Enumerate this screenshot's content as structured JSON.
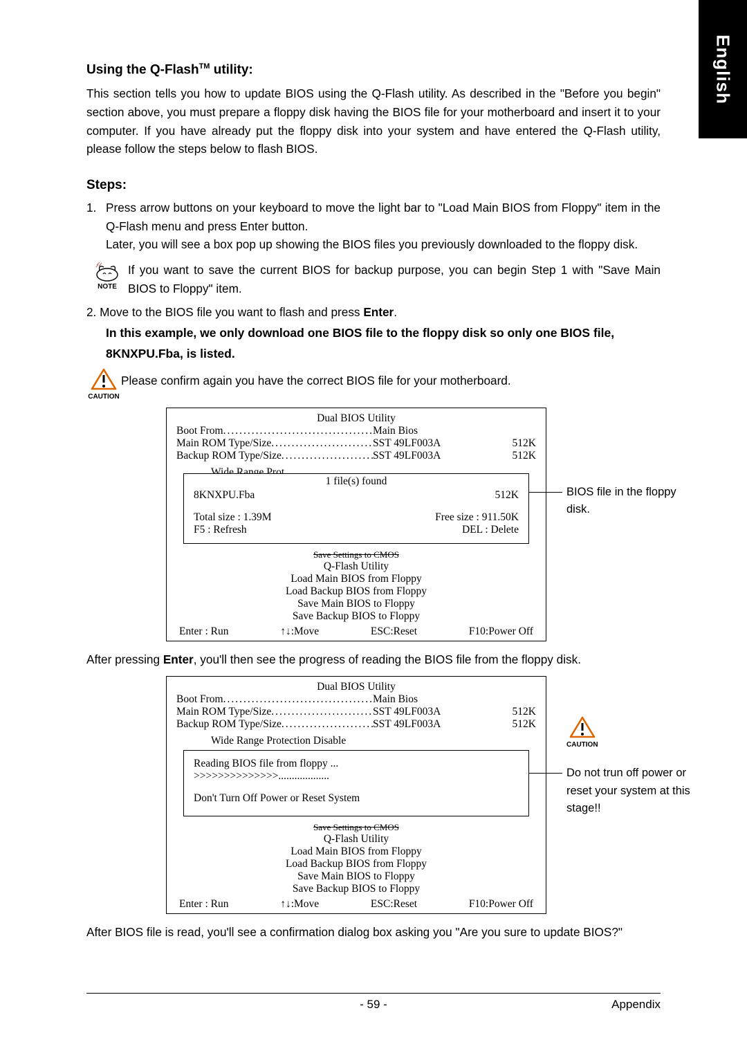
{
  "sideTab": "English",
  "heading1_prefix": "Using the Q-Flash",
  "heading1_tm": "TM",
  "heading1_suffix": " utility:",
  "intro": "This section tells you how to update BIOS using the Q-Flash utility. As described in the \"Before you begin\" section above, you must prepare a floppy disk having the BIOS file for your motherboard and insert it to your computer. If you have already put the floppy disk into your system and have entered the Q-Flash utility, please follow the steps below to flash BIOS.",
  "stepsHeading": "Steps:",
  "step1num": "1.",
  "step1a": "Press arrow buttons on your keyboard to move the light bar to \"Load Main BIOS from Floppy\" item in the Q-Flash menu and press Enter button.",
  "step1b": "Later, you will see a box pop up showing the BIOS files you previously downloaded to the floppy disk.",
  "noteLabel": "NOTE",
  "noteText": "If you want to save the current BIOS for backup purpose, you can begin Step 1 with \"Save Main BIOS to Floppy\" item.",
  "step2_prefix": "2. Move to the BIOS file you want to flash and press ",
  "step2_enter": "Enter",
  "step2_suffix": ".",
  "boldLine1": "In this example, we only download one BIOS file to the floppy disk so only one BIOS file,",
  "boldLine2": "8KNXPU.Fba, is listed.",
  "cautionLabel": "CAUTION",
  "cautionText": "Please confirm again you have the correct BIOS file for your motherboard.",
  "bios": {
    "title": "Dual BIOS Utility",
    "bootFromLabel": "Boot From",
    "bootFromVal": "Main Bios",
    "mainRomLabel": "Main ROM Type/Size",
    "mainRomVal": "SST 49LF003A",
    "mainRomK": "512K",
    "backupRomLabel": "Backup ROM Type/Size",
    "backupRomVal": "SST 49LF003A",
    "backupRomK": "512K",
    "wideRangeLabel": "Wide Range Prot",
    "wideRangeSuffix": "ection     Disable",
    "filesFound": "1 file(s) found",
    "fileName": "8KNXPU.Fba",
    "fileSize": "512K",
    "totalSize": "Total size : 1.39M",
    "freeSize": "Free size : 911.50K",
    "f5": "F5 : Refresh",
    "del": "DEL : Delete",
    "strike": "Save Settings to CMOS",
    "qflash": "Q-Flash Utility",
    "menu1": "Load Main BIOS from Floppy",
    "menu2": "Load Backup BIOS from Floppy",
    "menu3": "Save Main BIOS to Floppy",
    "menu4": "Save Backup BIOS to Floppy",
    "kEnter": "Enter : Run",
    "kMove": "↑↓:Move",
    "kEsc": "ESC:Reset",
    "kF10": "F10:Power Off"
  },
  "callout1": "BIOS file in the floppy disk.",
  "afterEnter_prefix": "After pressing ",
  "afterEnter_bold": "Enter",
  "afterEnter_suffix": ", you'll then see the progress of reading the BIOS file from the floppy disk.",
  "bios2": {
    "wideRange": "Wide Range Protection     Disable",
    "reading": "Reading BIOS file from floppy ...",
    "progress": ">>>>>>>>>>>>>>...................",
    "warn": "Don't Turn Off Power or Reset System"
  },
  "callout2": "Do not trun off power or reset your system at this stage!!",
  "afterRead": "After BIOS file is read, you'll see a confirmation dialog box asking you \"Are you sure to update BIOS?\"",
  "pageNum": "- 59 -",
  "footerRight": "Appendix"
}
